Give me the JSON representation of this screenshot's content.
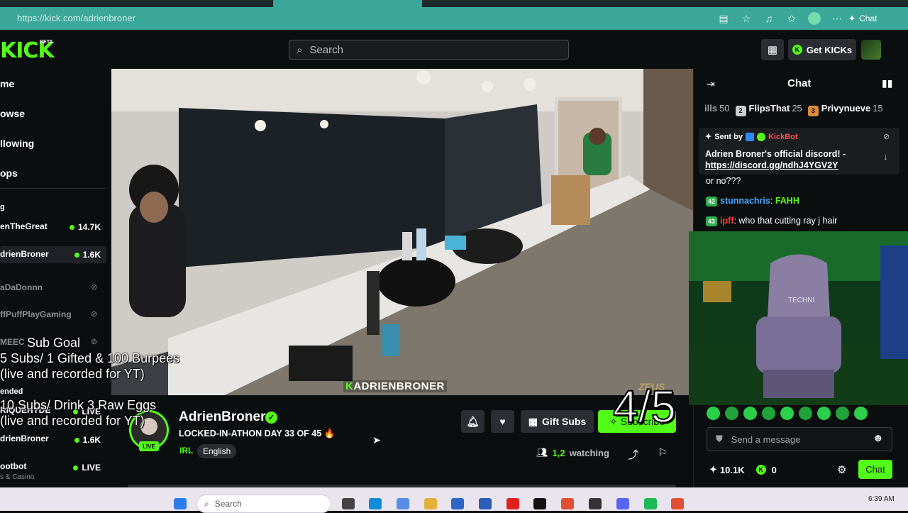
{
  "browser": {
    "url": "https://kick.com/adrienbroner",
    "chat_label": "Chat"
  },
  "header": {
    "logo": "KICK",
    "logo_badge": "BETA",
    "search_placeholder": "Search",
    "get_kicks_label": "Get KICKs"
  },
  "sidebar": {
    "nav": [
      "me",
      "owse",
      "llowing",
      "ops"
    ],
    "section_following": "g",
    "channels": [
      {
        "name": "enTheGreat",
        "count": "14.7K",
        "live": true
      },
      {
        "name": "drienBroner",
        "count": "1.6K",
        "live": true,
        "selected": true
      },
      {
        "name": "aDaDonnn",
        "live": false
      },
      {
        "name": "ffPuffPlayGaming",
        "live": false
      },
      {
        "name": "MEEC",
        "live": false
      }
    ],
    "section_recommended": "ended",
    "recommended": [
      {
        "name": "RIQUEHYDE",
        "count": "LIVE",
        "live": true
      },
      {
        "name": "drienBroner",
        "count": "1.6K",
        "live": true
      },
      {
        "name": "ootbot",
        "count": "LIVE",
        "live": true,
        "sub": "s & Casino"
      }
    ]
  },
  "video": {
    "watermark_prefix": "K",
    "watermark": "ADRIENBRONER",
    "corner_logo": "ZEUS"
  },
  "overlay": {
    "goal_title": "Sub Goal",
    "goal_line1": "5 Subs/ 1 Gifted & 100 Burpees",
    "goal_line2": "(live and recorded for YT)",
    "goal_line3": "10 Subs/ Drink 3 Raw Eggs",
    "goal_line4": "(live and recorded for YT)",
    "progress": "4/5"
  },
  "stream": {
    "streamer": "AdrienBroner",
    "title": "LOCKED-IN-ATHON DAY 33 OF 45",
    "title_emoji": "🔥",
    "category": "IRL",
    "language": "English",
    "live_badge": "LIVE",
    "gift_subs_label": "Gift Subs",
    "subscribe_label": "Subscribe",
    "viewers": "1,2",
    "watching_label": "watching"
  },
  "chat": {
    "title": "Chat",
    "leaderboard": [
      {
        "name": "ills",
        "value": "50",
        "badge_color": "#9aa0a4"
      },
      {
        "name": "FlipsThat",
        "value": "25",
        "badge_color": "#c9cdd0"
      },
      {
        "name": "Privynueve",
        "value": "15",
        "badge_color": "#d88a3b"
      }
    ],
    "pinned": {
      "sent_by_label": "Sent by",
      "bot": "KickBot",
      "message": "Adrien Broner's official discord! -",
      "link": "https://discord.gg/ndhJ4YGV2Y"
    },
    "messages": [
      {
        "text": "or no???"
      },
      {
        "level": "42",
        "user": "stunnachris",
        "user_color": "#4aa8ff",
        "text": "FAHH",
        "text_color": "#53fc18"
      },
      {
        "level": "43",
        "user": "ipff",
        "user_color": "#ff3b3b",
        "text": "who that cutting ray j hair"
      }
    ],
    "input_placeholder": "Send a message",
    "kicks_balance": "10.1K",
    "coins": "0",
    "send_label": "Chat"
  },
  "taskbar": {
    "search_placeholder": "Search",
    "time": "6:39 AM"
  }
}
